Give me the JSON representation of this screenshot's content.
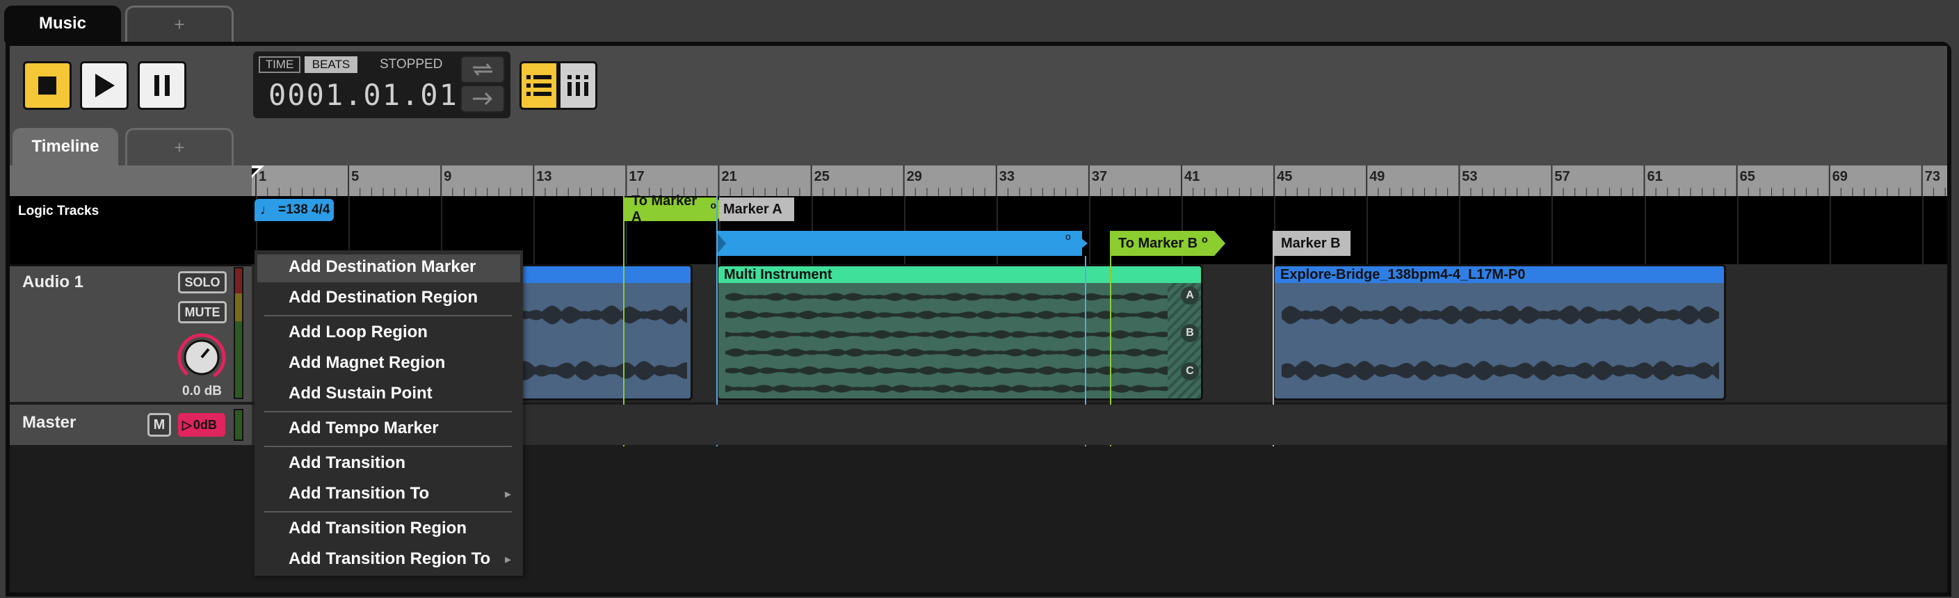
{
  "tabs": {
    "active": "Music",
    "add": "+"
  },
  "transport": {
    "time_label": "TIME",
    "beats_label": "BEATS",
    "status": "STOPPED",
    "position": "0001.01.01",
    "colors": {
      "accent": "#f5c635"
    }
  },
  "view_tabs": {
    "active": "Timeline",
    "add": "+"
  },
  "ruler": {
    "bars": [
      "1",
      "5",
      "9",
      "13",
      "17",
      "21",
      "25",
      "29",
      "33",
      "37",
      "41",
      "45",
      "49",
      "53",
      "57",
      "61",
      "65",
      "69",
      "73"
    ]
  },
  "logic_tracks": {
    "label": "Logic Tracks",
    "tempo": "=138 4/4",
    "to_marker_a": "To Marker A",
    "marker_a": "Marker A",
    "to_marker_b": "To Marker B",
    "marker_b": "Marker B"
  },
  "audio_track": {
    "name": "Audio 1",
    "solo": "SOLO",
    "mute": "MUTE",
    "volume": "0.0 dB",
    "clips": {
      "multi": "Multi Instrument",
      "multi_lanes": [
        "A",
        "B",
        "C"
      ],
      "explore": "Explore-Bridge_138bpm4-4_L17M-P0"
    }
  },
  "master_track": {
    "name": "Master",
    "mute": "M",
    "gain": "0dB"
  },
  "context_menu": {
    "items": [
      {
        "label": "Add Destination Marker"
      },
      {
        "label": "Add Destination Region"
      },
      {
        "label": "Add Loop Region"
      },
      {
        "label": "Add Magnet Region"
      },
      {
        "label": "Add Sustain Point"
      },
      {
        "label": "Add Tempo Marker"
      },
      {
        "label": "Add Transition"
      },
      {
        "label": "Add Transition To"
      },
      {
        "label": "Add Transition Region"
      },
      {
        "label": "Add Transition Region To"
      }
    ]
  }
}
